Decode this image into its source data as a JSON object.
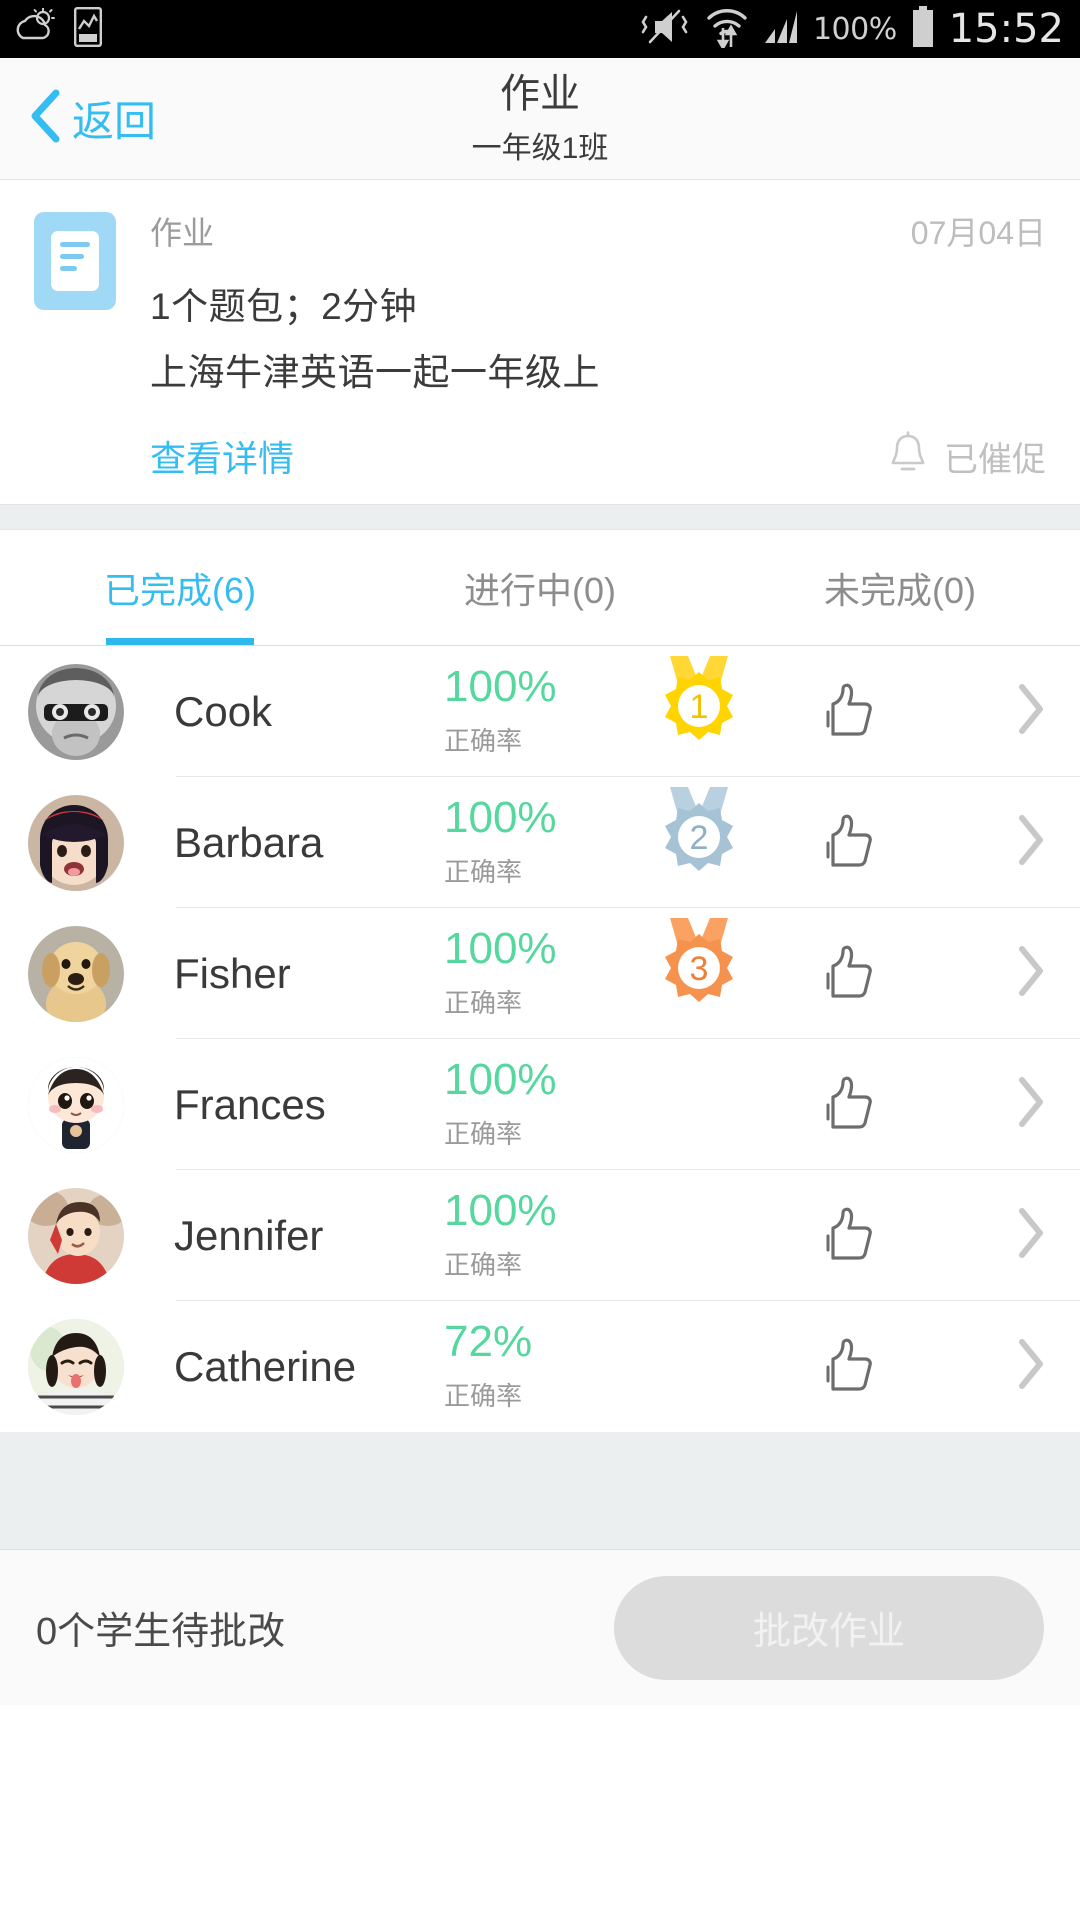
{
  "statusbar": {
    "weather_icon": "weather-cloud-sun-icon",
    "gallery_icon": "image-gallery-icon",
    "mute_icon": "vibrate-mute-icon",
    "wifi_icon": "wifi-data-transfer-icon",
    "signal_icon": "cellular-signal-icon",
    "battery_percent": "100%",
    "battery_icon": "battery-full-icon",
    "clock": "15:52"
  },
  "navbar": {
    "back_icon": "chevron-left-icon",
    "back_label": "返回",
    "title": "作业",
    "subtitle": "一年级1班"
  },
  "infocard": {
    "doc_icon": "document-lines-icon",
    "kind": "作业",
    "date": "07月04日",
    "line1": "1个题包；2分钟",
    "line2": "上海牛津英语一起一年级上",
    "detail_link": "查看详情",
    "bell_icon": "bell-icon",
    "urge_label": "已催促"
  },
  "tabs": [
    {
      "label": "已完成(6)",
      "active": true
    },
    {
      "label": "进行中(0)",
      "active": false
    },
    {
      "label": "未完成(0)",
      "active": false
    }
  ],
  "students": [
    {
      "name": "Cook",
      "percent": "100%",
      "rate_label": "正确率",
      "medal": "1",
      "avatar": "boy-glasses-bw-photo",
      "thumb_icon": "thumbs-up-icon",
      "chevron_icon": "chevron-right-icon"
    },
    {
      "name": "Barbara",
      "percent": "100%",
      "rate_label": "正确率",
      "medal": "2",
      "avatar": "girl-red-headband-photo",
      "thumb_icon": "thumbs-up-icon",
      "chevron_icon": "chevron-right-icon"
    },
    {
      "name": "Fisher",
      "percent": "100%",
      "rate_label": "正确率",
      "medal": "3",
      "avatar": "golden-puppy-photo",
      "thumb_icon": "thumbs-up-icon",
      "chevron_icon": "chevron-right-icon"
    },
    {
      "name": "Frances",
      "percent": "100%",
      "rate_label": "正确率",
      "medal": "",
      "avatar": "cartoon-boy-avatar",
      "thumb_icon": "thumbs-up-icon",
      "chevron_icon": "chevron-right-icon"
    },
    {
      "name": "Jennifer",
      "percent": "100%",
      "rate_label": "正确率",
      "medal": "",
      "avatar": "girl-red-shirt-photo",
      "thumb_icon": "thumbs-up-icon",
      "chevron_icon": "chevron-right-icon"
    },
    {
      "name": "Catherine",
      "percent": "72%",
      "rate_label": "正确率",
      "medal": "",
      "avatar": "girl-striped-shirt-photo",
      "thumb_icon": "thumbs-up-icon",
      "chevron_icon": "chevron-right-icon"
    }
  ],
  "footer": {
    "pending_text": "0个学生待批改",
    "button_label": "批改作业"
  },
  "colors": {
    "accent_blue": "#35bdf2",
    "score_green": "#55d79e",
    "medal_gold": "#ffd400",
    "medal_silver": "#a6c3d6",
    "medal_bronze": "#f5924e",
    "doc_icon_blue": "#9fd9f6",
    "disabled_gray": "#dcdcdc"
  }
}
